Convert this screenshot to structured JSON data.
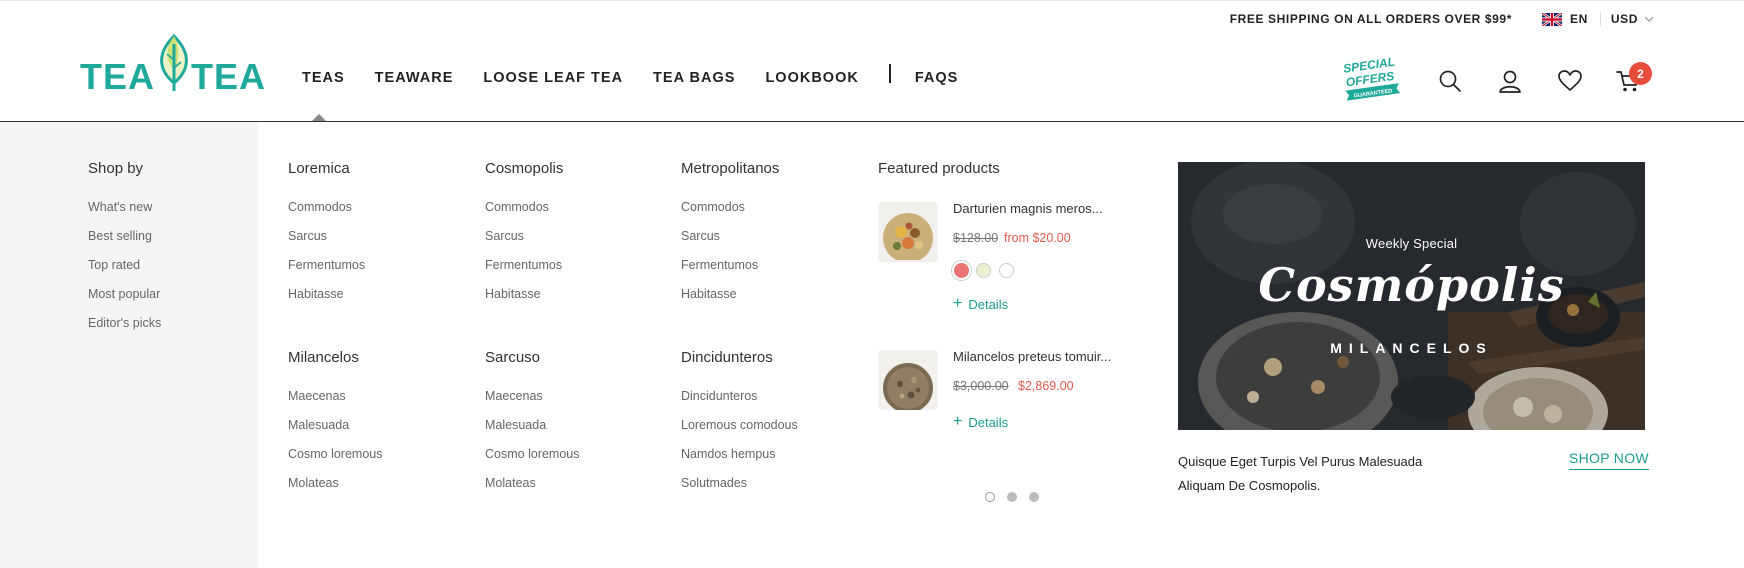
{
  "topbar": {
    "shipping": "FREE SHIPPING ON ALL ORDERS OVER $99*",
    "language": "EN",
    "currency": "USD"
  },
  "brand": {
    "left": "TEA",
    "right": "TEA",
    "color": "#1fa99a"
  },
  "nav": {
    "items": [
      "TEAS",
      "TEAWARE",
      "LOOSE LEAF TEA",
      "TEA BAGS",
      "LOOKBOOK",
      "FAQS"
    ],
    "active": "TEAS"
  },
  "special_offers": {
    "line1": "SPECIAL",
    "line2": "OFFERS",
    "ribbon": "GUARANTEED"
  },
  "cart": {
    "count": "2"
  },
  "menu": {
    "shop_by": {
      "title": "Shop by",
      "links": [
        "What's new",
        "Best selling",
        "Top rated",
        "Most popular",
        "Editor's picks"
      ]
    },
    "columns": [
      {
        "title": "Loremica",
        "links": [
          "Commodos",
          "Sarcus",
          "Fermentumos",
          "Habitasse"
        ]
      },
      {
        "title": "Cosmopolis",
        "links": [
          "Commodos",
          "Sarcus",
          "Fermentumos",
          "Habitasse"
        ]
      },
      {
        "title": "Metropolitanos",
        "links": [
          "Commodos",
          "Sarcus",
          "Fermentumos",
          "Habitasse"
        ]
      },
      {
        "title": "Milancelos",
        "links": [
          "Maecenas",
          "Malesuada",
          "Cosmo loremous",
          "Molateas"
        ]
      },
      {
        "title": "Sarcuso",
        "links": [
          "Maecenas",
          "Malesuada",
          "Cosmo loremous",
          "Molateas"
        ]
      },
      {
        "title": "Dincidunteros",
        "links": [
          "Dincidunteros",
          "Loremous comodous",
          "Namdos hempus",
          "Solutmades"
        ]
      }
    ],
    "featured": {
      "title": "Featured products",
      "products": [
        {
          "name": "Darturien magnis meros...",
          "old_price": "$128.00",
          "price": "from $20.00",
          "details": "Details",
          "swatches": [
            "#e87474",
            "#eef0d4",
            "#ffffff"
          ]
        },
        {
          "name": "Milancelos preteus tomuir...",
          "old_price": "$3,000.00",
          "price": "$2,869.00",
          "details": "Details"
        }
      ]
    },
    "banner": {
      "kicker": "Weekly Special",
      "title": "Cosmópolis",
      "subtitle": "MILANCELOS",
      "description": "Quisque Eget Turpis Vel Purus Malesuada Aliquam De Cosmopolis.",
      "cta": "SHOP NOW"
    }
  }
}
